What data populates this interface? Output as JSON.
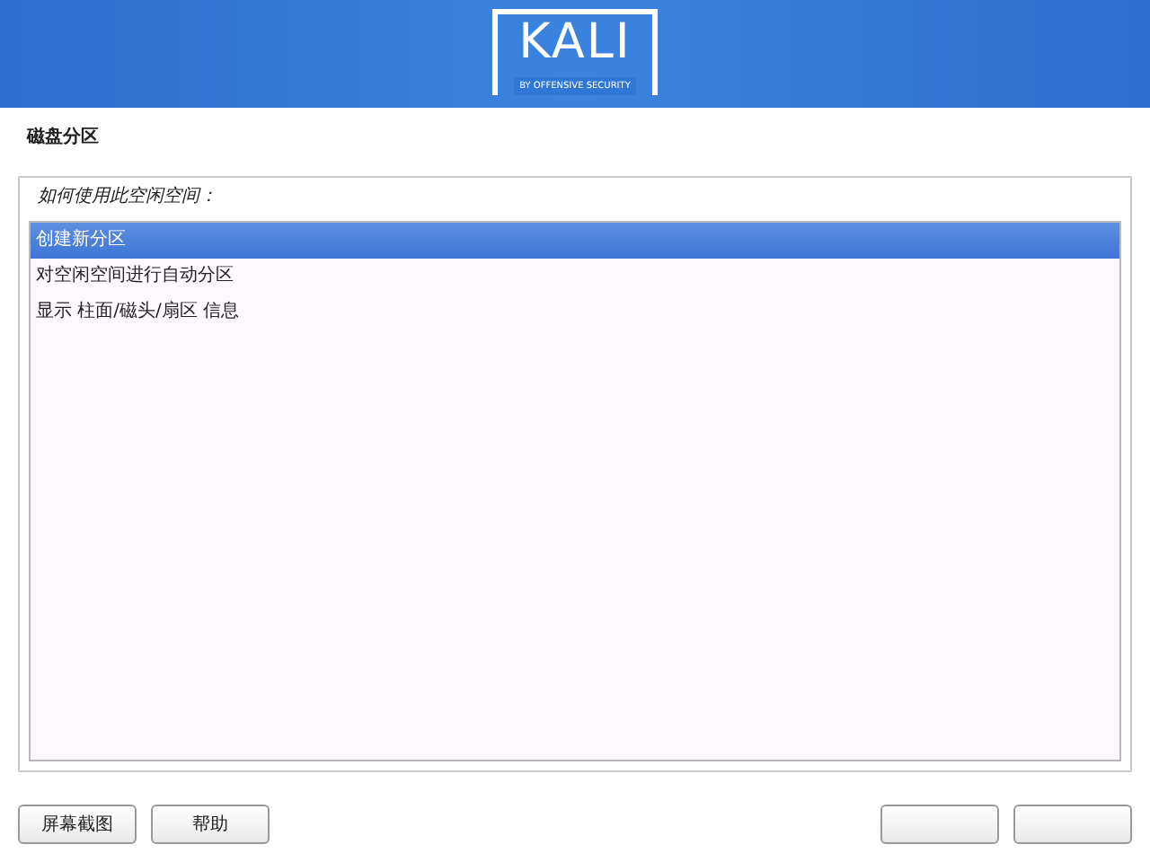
{
  "header": {
    "logo_text": "KALI",
    "logo_tagline": "BY OFFENSIVE SECURITY"
  },
  "page_title": "磁盘分区",
  "question": "如何使用此空闲空间：",
  "options": [
    {
      "label": "创建新分区",
      "selected": true
    },
    {
      "label": "对空闲空间进行自动分区",
      "selected": false
    },
    {
      "label": "显示 柱面/磁头/扇区 信息",
      "selected": false
    }
  ],
  "buttons": [
    "屏幕截图",
    "帮助"
  ]
}
